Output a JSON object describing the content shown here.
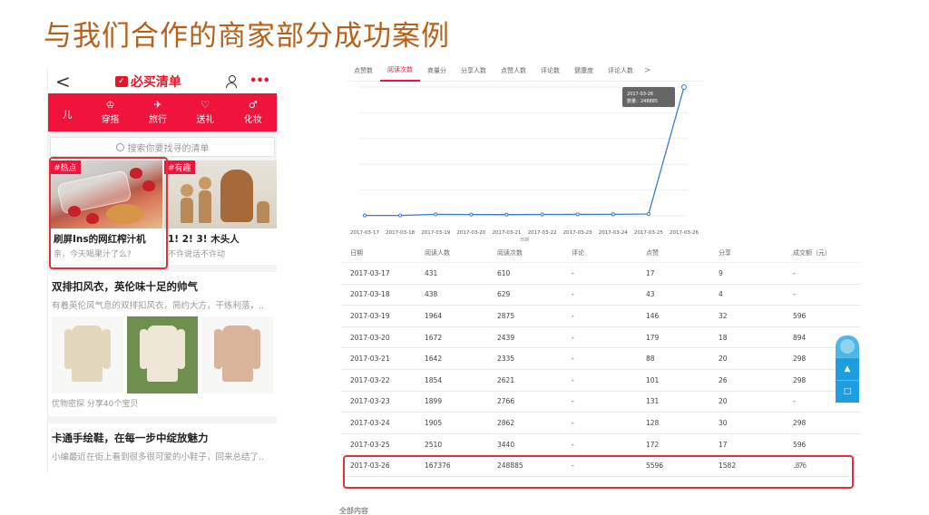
{
  "slide": {
    "title": "与我们合作的商家部分成功案例"
  },
  "phone": {
    "nav": {
      "back": "<",
      "logo": "必买清单",
      "menu": "•••"
    },
    "categories": [
      {
        "icon": "",
        "label": "儿"
      },
      {
        "icon": "♔",
        "label": "穿搭"
      },
      {
        "icon": "✈",
        "label": "旅行"
      },
      {
        "icon": "♡",
        "label": "送礼"
      },
      {
        "icon": "♂",
        "label": "化妆"
      }
    ],
    "search_placeholder": "搜索你要找寻的清单",
    "cards": [
      {
        "tag": "#热点",
        "title": "刷屏Ins的网红榨汁机",
        "subtitle": "亲，今天喝果汁了么?"
      },
      {
        "tag": "#有趣",
        "title": "1! 2! 3! 木头人",
        "subtitle": "不许说话不许动"
      }
    ],
    "articles": [
      {
        "title": "双排扣风衣，英伦味十足的帅气",
        "desc": "有着英伦风气息的双排扣风衣，简约大方，干练利落，..",
        "meta": "优物密探 分享40个宝贝"
      },
      {
        "title": "卡通手绘鞋，在每一步中绽放魅力",
        "desc": "小编最近在街上看到很多很可爱的小鞋子，回来总结了..",
        "meta": ""
      }
    ]
  },
  "analytics": {
    "tabs": [
      "点赞数",
      "阅读次数",
      "商量分",
      "分享人数",
      "点赞人数",
      "评论数",
      "健康度",
      "评论人数"
    ],
    "active_tab": 1,
    "tab_more": ">",
    "tooltip": {
      "date": "2017-03-26",
      "label": "数量：248885"
    },
    "x_axis_title": "日期"
  },
  "chart_data": {
    "type": "line",
    "title": "",
    "xlabel": "日期",
    "ylabel": "",
    "x": [
      "2017-03-17",
      "2017-03-18",
      "2017-03-19",
      "2017-03-20",
      "2017-03-21",
      "2017-03-22",
      "2017-03-23",
      "2017-03-24",
      "2017-03-25",
      "2017-03-26"
    ],
    "series": [
      {
        "values": [
          610,
          629,
          2875,
          2439,
          2335,
          2621,
          2766,
          2862,
          3440,
          248885
        ]
      }
    ],
    "ylim": [
      0,
      248885
    ],
    "grid": true,
    "color": "#3a7bd5"
  },
  "table": {
    "headers": [
      "日期",
      "阅读人数",
      "阅读次数",
      "评论",
      "点赞",
      "分享",
      "成交额（元）"
    ],
    "rows": [
      [
        "2017-03-17",
        "431",
        "610",
        "-",
        "17",
        "9",
        "-"
      ],
      [
        "2017-03-18",
        "438",
        "629",
        "-",
        "43",
        "4",
        "-"
      ],
      [
        "2017-03-19",
        "1964",
        "2875",
        "-",
        "146",
        "32",
        "596"
      ],
      [
        "2017-03-20",
        "1672",
        "2439",
        "-",
        "179",
        "18",
        "894"
      ],
      [
        "2017-03-21",
        "1642",
        "2335",
        "-",
        "88",
        "20",
        "298"
      ],
      [
        "2017-03-22",
        "1854",
        "2621",
        "-",
        "101",
        "26",
        "298"
      ],
      [
        "2017-03-23",
        "1899",
        "2766",
        "-",
        "131",
        "20",
        "-"
      ],
      [
        "2017-03-24",
        "1905",
        "2862",
        "-",
        "128",
        "30",
        "298"
      ],
      [
        "2017-03-25",
        "2510",
        "3440",
        "-",
        "172",
        "17",
        "596"
      ],
      [
        "2017-03-26",
        "167376",
        "248885",
        "-",
        "5596",
        "1582",
        "..876"
      ]
    ],
    "footer": "全部内容"
  },
  "colors": {
    "title": "#b4621c",
    "brand_red": "#f0133c",
    "highlight": "#e0303a",
    "line": "#3a7bd5",
    "widget": "#1e9ee0"
  }
}
